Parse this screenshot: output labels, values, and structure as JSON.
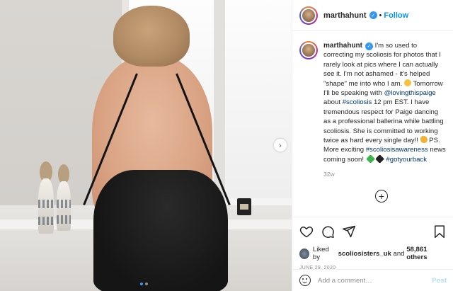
{
  "post": {
    "username": "marthahunt",
    "separator": "•",
    "follow_label": "Follow",
    "verified_glyph": "✓",
    "caption_parts": {
      "p1": "I'm so used to correcting my scoliosis for photos that I rarely look at pics where I can actually see it. I'm not ashamed - it's helped \"shape\" me into who I am. ",
      "p2": " Tomorrow I'll be speaking with ",
      "mention": "@lovingthispaige",
      "p3": " about ",
      "tag1": "#scoliosis",
      "p4": " 12 pm EST. I have tremendous respect for Paige dancing as a professional ballerina while battling scoliosis. She is committed to working twice as hard every single day!! ",
      "p5": " PS. More exciting ",
      "tag2": "#scoliosisawareness",
      "p6": " news coming soon! ",
      "tag3": "#gotyourback"
    },
    "time_ago": "32w",
    "load_more_glyph": "+",
    "likes": {
      "prefix": "Liked by ",
      "user": "scoliosisters_uk",
      "middle": " and ",
      "count": "58,861 others"
    },
    "date": "JUNE 29, 2020",
    "comment_input": {
      "placeholder": "Add a comment…",
      "value": ""
    },
    "post_label": "Post"
  },
  "carousel": {
    "next_glyph": "›",
    "total_slides": 2,
    "active_slide": 1
  },
  "icons": {
    "like": "heart-icon",
    "comment": "comment-icon",
    "share": "share-icon",
    "save": "bookmark-icon",
    "emoji": "emoji-icon"
  },
  "colors": {
    "link": "#00376b",
    "follow": "#0095f6",
    "verified": "#3897f0",
    "muted": "#8e8e8e",
    "post_disabled": "#b2dffc"
  }
}
